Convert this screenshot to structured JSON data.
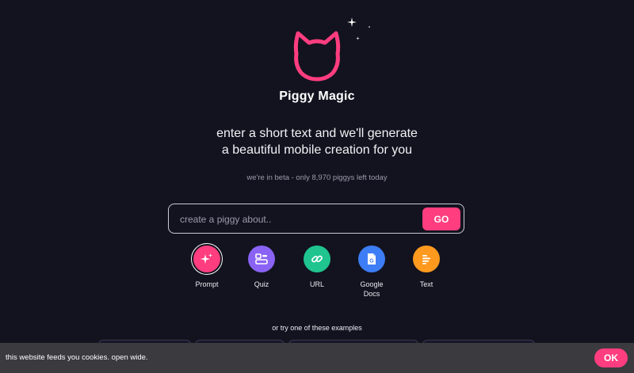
{
  "brand": {
    "name": "Piggy Magic",
    "logo_icon": "cat-head-icon",
    "accent_color": "#ff3d7f"
  },
  "hero": {
    "headline_line1": "enter a short text and we'll generate",
    "headline_line2": "a beautiful mobile creation for you",
    "beta_note": "we're in beta - only 8,970 piggys left today"
  },
  "search": {
    "placeholder": "create a piggy about..",
    "value": "",
    "go_label": "GO"
  },
  "modes": [
    {
      "label": "Prompt",
      "icon": "sparkles-icon",
      "color": "#ff3d7f",
      "selected": true
    },
    {
      "label": "Quiz",
      "icon": "quiz-icon",
      "color": "#8a63f5",
      "selected": false
    },
    {
      "label": "URL",
      "icon": "link-icon",
      "color": "#1fc48f",
      "selected": false
    },
    {
      "label_line1": "Google",
      "label_line2": "Docs",
      "icon": "google-docs-icon",
      "color": "#3d7df5",
      "selected": false
    },
    {
      "label": "Text",
      "icon": "text-lines-icon",
      "color": "#ff9a1f",
      "selected": false
    }
  ],
  "examples": {
    "heading": "or try one of these examples"
  },
  "cookie_banner": {
    "text": "this website feeds you cookies. open wide.",
    "ok_label": "OK"
  }
}
